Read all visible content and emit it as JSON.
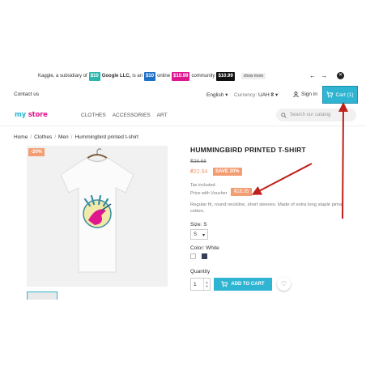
{
  "promo": {
    "prefix": "Kaggle, a subsidiary of",
    "chip1": "$10",
    "company": "Google LLC,",
    "mid": "is an",
    "chip2": "$10",
    "online": "online",
    "chip3": "$10.99",
    "community": "community",
    "chip4": "$10.99",
    "show_more": "show more",
    "nav": "← →",
    "close": "✕"
  },
  "topnav": {
    "contact": "Contact us",
    "language": "English ▾",
    "currency_label": "Currency:",
    "currency_value": "UAH ₴ ▾",
    "signin": "Sign in",
    "cart": "Cart (1)"
  },
  "header": {
    "logo_my": "my",
    "logo_store": "store",
    "menu": [
      "CLOTHES",
      "ACCESSORIES",
      "ART"
    ],
    "search_placeholder": "Search our catalog"
  },
  "breadcrumb": [
    "Home",
    "Clothes",
    "Men",
    "Hummingbird printed t-shirt"
  ],
  "product": {
    "flag": "-20%",
    "title": "HUMMINGBIRD PRINTED T-SHIRT",
    "old_price": "₴28.68",
    "new_price": "₴22.94",
    "discount": "SAVE 20%",
    "tax": "Tax included",
    "voucher_label": "Price with Voucher",
    "voucher_price": "₴18.35",
    "description": "Regular fit, round neckline, short sleeves. Made of extra long staple pima cotton.",
    "size_label": "Size: S",
    "size_value": "S",
    "color_label": "Color: White",
    "quantity_label": "Quantity",
    "quantity_value": "1",
    "add_to_cart": "ADD TO CART"
  },
  "colors": {
    "accent": "#2fb5d2",
    "discount": "#f39d72",
    "arrow": "#c0201a"
  }
}
